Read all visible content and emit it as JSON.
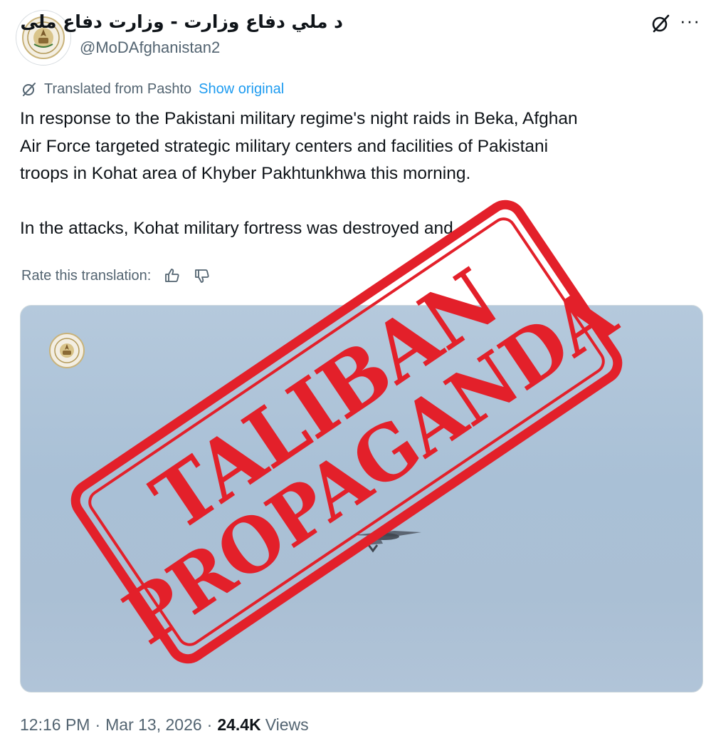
{
  "author": {
    "display_name": "د ملي دفاع وزارت - وزارت دفاع ملی",
    "handle": "@MoDAfghanistan2"
  },
  "translation": {
    "note": "Translated from Pashto",
    "show_original": "Show original",
    "rate_label": "Rate this translation:"
  },
  "tweet": {
    "lines_p1": [
      "In response to the Pakistani military regime's night raids in Beka, Afghan",
      "Air Force targeted strategic military centers and facilities of Pakistani",
      "troops in Kohat area of Khyber Pakhtunkhwa this morning."
    ],
    "line_p2": "In the attacks, Kohat military fortress was destroyed and"
  },
  "footer": {
    "time": "12:16 PM",
    "separator": "·",
    "date": "Mar 13, 2026",
    "views_count": "24.4K",
    "views_label": "Views"
  },
  "stamp": {
    "line1": "TALIBAN",
    "line2": "PROPAGANDA",
    "color": "#e3202a"
  },
  "icons": {
    "grok": "grok-icon",
    "more": "more-options-icon",
    "translate": "translate-icon",
    "thumbs_up": "thumbs-up-icon",
    "thumbs_down": "thumbs-down-icon"
  },
  "colors": {
    "link": "#1d9bf0",
    "secondary_text": "#536471",
    "primary_text": "#0f1419",
    "sky": "#aabfd4"
  }
}
